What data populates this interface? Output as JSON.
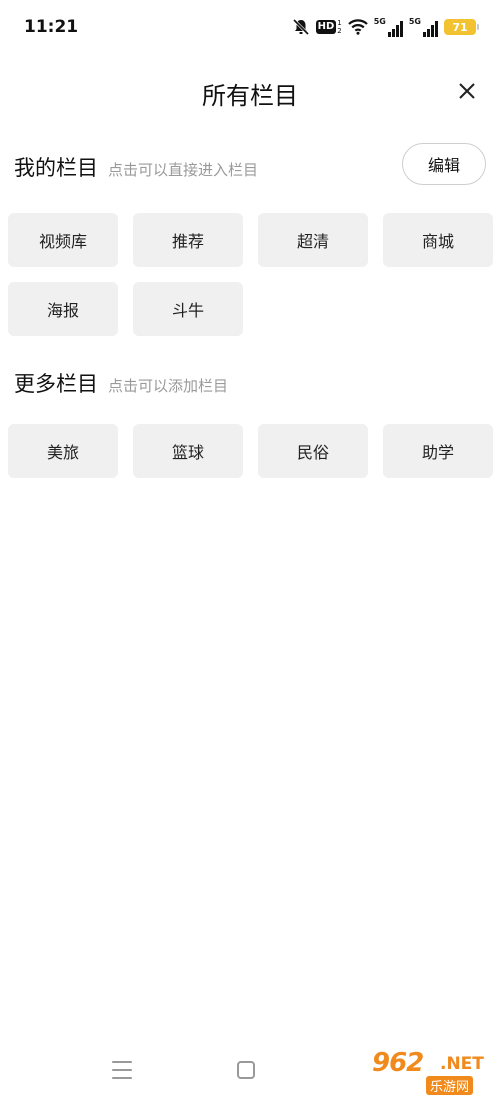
{
  "status_bar": {
    "time": "11:21",
    "hd_label": "HD",
    "hd_sub": [
      "1",
      "2"
    ],
    "net_label": "5G",
    "net_label_2": "5G",
    "battery": "71",
    "battery_color": "#f2c230"
  },
  "header": {
    "title": "所有栏目",
    "close_icon": "close-icon"
  },
  "my_section": {
    "title": "我的栏目",
    "hint": "点击可以直接进入栏目",
    "edit_label": "编辑",
    "items": [
      "视频库",
      "推荐",
      "超清",
      "商城",
      "海报",
      "斗牛"
    ]
  },
  "more_section": {
    "title": "更多栏目",
    "hint": "点击可以添加栏目",
    "items": [
      "美旅",
      "篮球",
      "民俗",
      "助学"
    ]
  },
  "watermark": {
    "number": "962",
    "net": ".NET",
    "cn": "乐游网"
  },
  "colors": {
    "chip_bg": "#f0f0f0",
    "hint_text": "#9a9a9a",
    "watermark": "#f08a1c"
  }
}
